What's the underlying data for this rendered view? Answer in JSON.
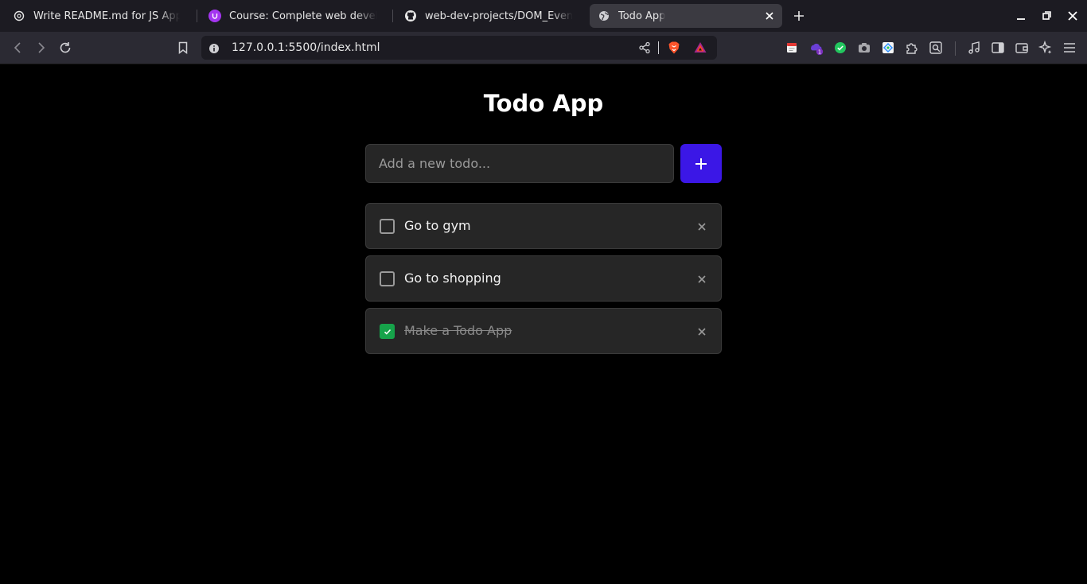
{
  "browser": {
    "tabs": [
      {
        "title": "Write README.md for JS App",
        "icon": "openai-icon"
      },
      {
        "title": "Course: Complete web developme",
        "icon": "udemy-icon"
      },
      {
        "title": "web-dev-projects/DOM_Events at",
        "icon": "github-icon"
      },
      {
        "title": "Todo App",
        "icon": "globe-icon",
        "active": true
      }
    ],
    "url": "127.0.0.1:5500/index.html",
    "extension_badge": "1"
  },
  "app": {
    "title": "Todo App",
    "input_placeholder": "Add a new todo...",
    "input_value": "",
    "add_label": "+",
    "todos": [
      {
        "text": "Go to gym",
        "done": false
      },
      {
        "text": "Go to shopping",
        "done": false
      },
      {
        "text": "Make a Todo App",
        "done": true
      }
    ]
  },
  "colors": {
    "accent": "#3b17e6",
    "check": "#16a34a",
    "background": "#000000",
    "card": "#262626"
  }
}
